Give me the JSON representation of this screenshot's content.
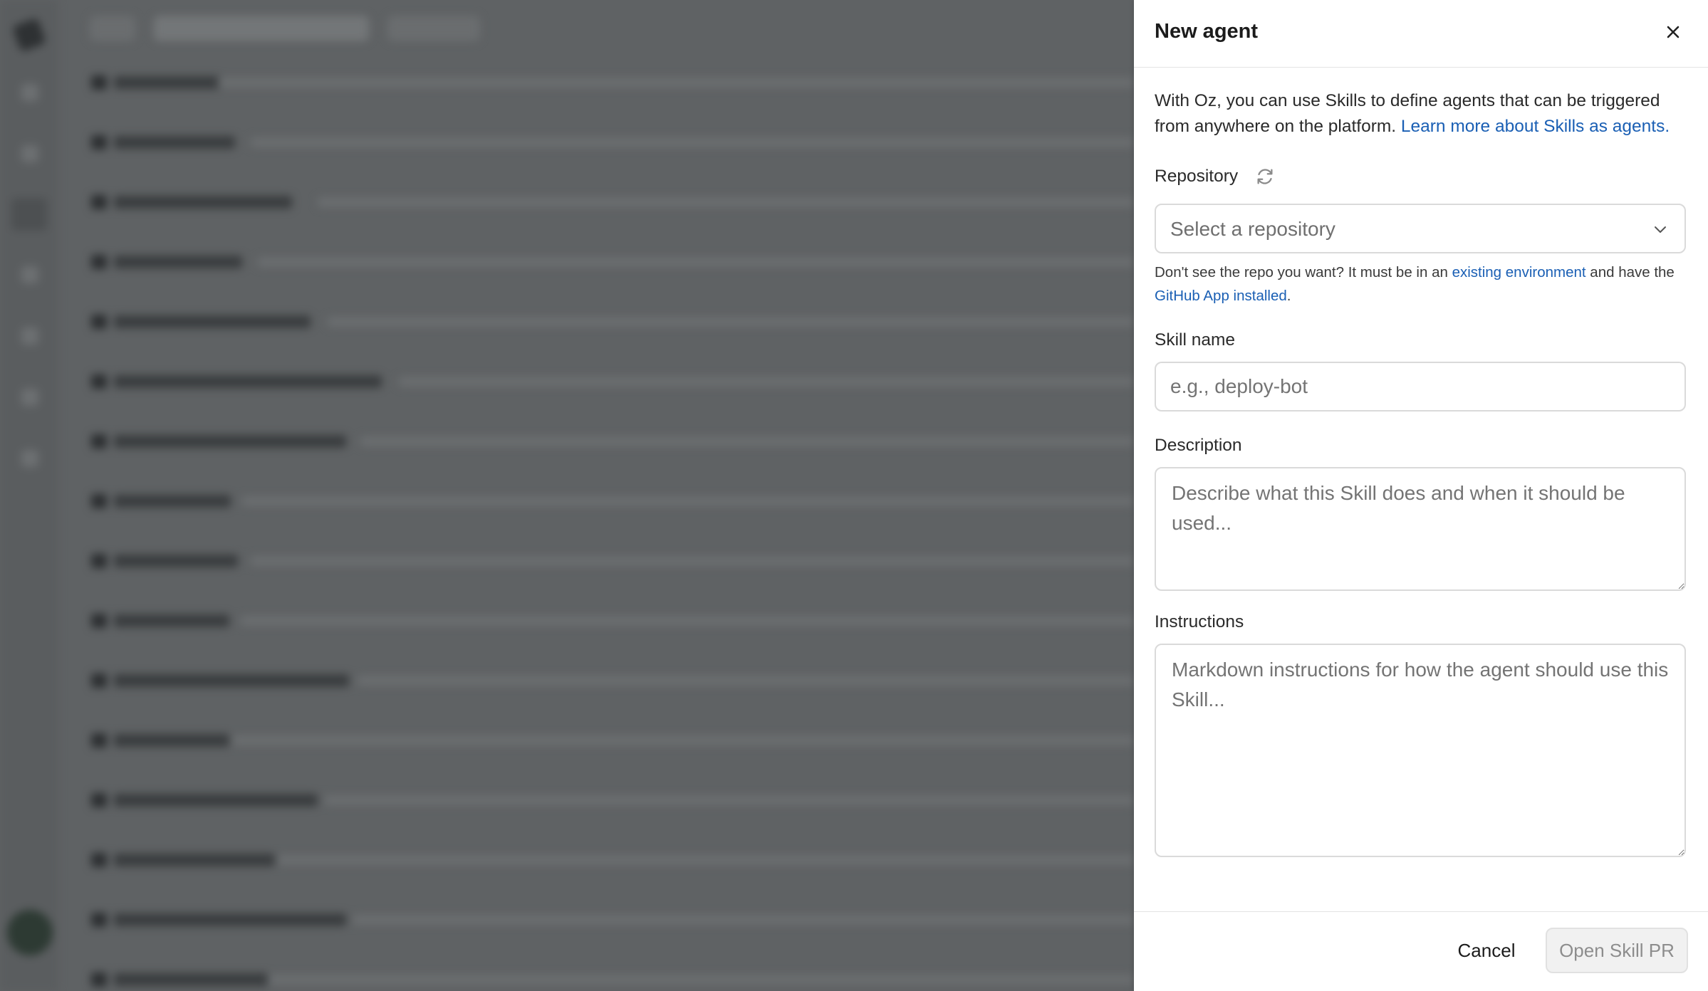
{
  "drawer": {
    "title": "New agent",
    "intro_text": "With Oz, you can use Skills to define agents that can be triggered from anywhere on the platform. ",
    "intro_link": "Learn more about Skills as agents.",
    "repository": {
      "label": "Repository",
      "placeholder": "Select a repository",
      "refresh_icon": "refresh-icon",
      "chevron_icon": "chevron-down-icon"
    },
    "hint": {
      "prefix": "Don't see the repo you want? It must be in an ",
      "link1": "existing environment",
      "middle": " and have the ",
      "link2": "GitHub App installed",
      "suffix": "."
    },
    "skill_name": {
      "label": "Skill name",
      "placeholder": "e.g., deploy-bot"
    },
    "description": {
      "label": "Description",
      "placeholder": "Describe what this Skill does and when it should be used..."
    },
    "instructions": {
      "label": "Instructions",
      "placeholder": "Markdown instructions for how the agent should use this Skill..."
    },
    "footer": {
      "cancel_label": "Cancel",
      "submit_label": "Open Skill PR"
    }
  },
  "colors": {
    "link": "#1a5fb4",
    "overlay": "#5f6264",
    "disabled_button_bg": "#f1f1f1",
    "disabled_button_text": "#8d8d8d"
  }
}
